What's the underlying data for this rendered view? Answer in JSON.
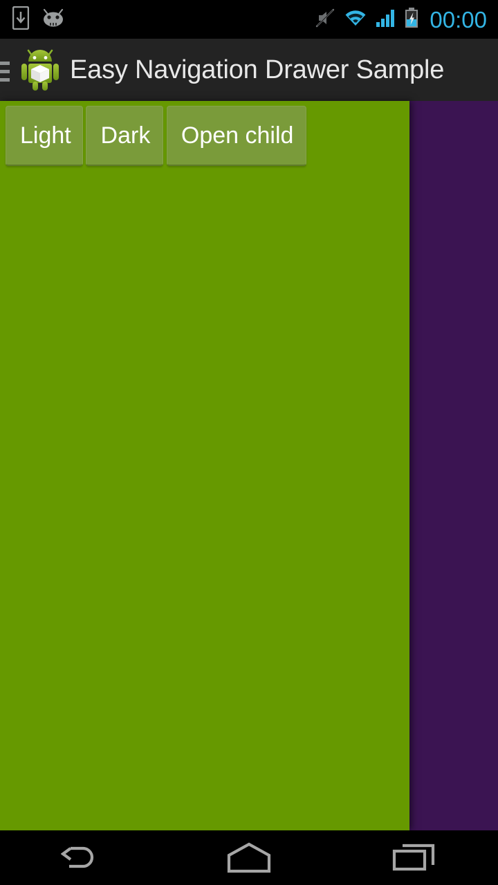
{
  "status_bar": {
    "background": "#000000",
    "clock": "00:00",
    "clock_color": "#33b5e5",
    "left_icons": [
      {
        "name": "download-to-device-icon",
        "label": "USB / download notification"
      },
      {
        "name": "android-face-icon",
        "label": "Android system notification"
      }
    ],
    "right_icons": [
      {
        "name": "ringer-muted-icon",
        "label": "Ringer silenced"
      },
      {
        "name": "wifi-icon",
        "label": "Wi-Fi connected"
      },
      {
        "name": "cellular-signal-icon",
        "label": "Cellular signal"
      },
      {
        "name": "battery-charging-icon",
        "label": "Battery charging"
      }
    ]
  },
  "action_bar": {
    "background": "#232323",
    "title": "Easy Navigation Drawer Sample",
    "title_color": "#e8e8e8",
    "drawer_toggle_name": "hamburger-menu-icon",
    "app_icon_name": "android-app-icon"
  },
  "drawer": {
    "background": "#669900",
    "open": true,
    "buttons": [
      {
        "label": "Light",
        "name": "light-theme-button"
      },
      {
        "label": "Dark",
        "name": "dark-theme-button"
      },
      {
        "label": "Open child",
        "name": "open-child-button"
      }
    ]
  },
  "content": {
    "background": "#3b1452"
  },
  "nav_bar": {
    "background": "#000000",
    "buttons": [
      {
        "name": "nav-back-button",
        "label": "Back"
      },
      {
        "name": "nav-home-button",
        "label": "Home"
      },
      {
        "name": "nav-recents-button",
        "label": "Recents"
      }
    ]
  }
}
